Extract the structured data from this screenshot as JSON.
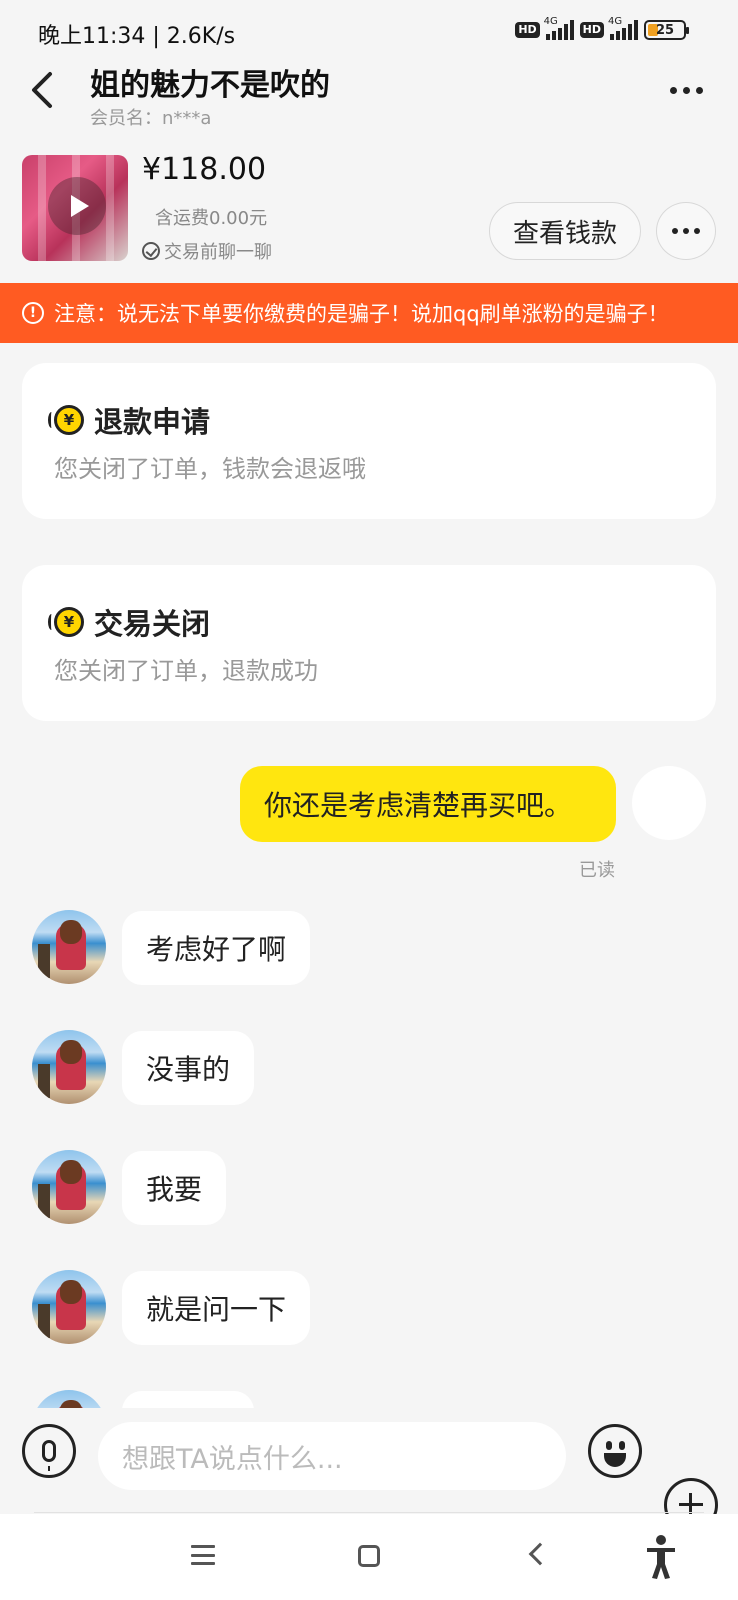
{
  "status_bar": {
    "time": "晚上11:34 | 2.6K/s",
    "hd_badge": "HD",
    "network_badge": "4G",
    "battery": "25"
  },
  "header": {
    "title": "姐的魅力不是吹的",
    "member_name": "会员名：n***a"
  },
  "product": {
    "price": "¥118.00",
    "shipping": "含运费0.00元",
    "chat_hint": "交易前聊一聊",
    "view_money_label": "查看钱款"
  },
  "warning": {
    "text": "注意：说无法下单要你缴费的是骗子！说加qq刷单涨粉的是骗子！"
  },
  "system_cards": [
    {
      "title": "退款申请",
      "desc": "您关闭了订单，钱款会退返哦"
    },
    {
      "title": "交易关闭",
      "desc": "您关闭了订单，退款成功"
    }
  ],
  "messages": {
    "mine": "你还是考虑清楚再买吧。",
    "read_status": "已读",
    "theirs": [
      "考虑好了啊",
      "没事的",
      "我要",
      "就是问一下",
      ""
    ]
  },
  "input": {
    "placeholder": "想跟TA说点什么..."
  },
  "icons": {
    "yen_symbol": "¥",
    "warning_symbol": "!"
  },
  "colors": {
    "warning_bg": "#ff5b22",
    "my_bubble": "#ffe60f",
    "yen_icon": "#ffd500"
  }
}
